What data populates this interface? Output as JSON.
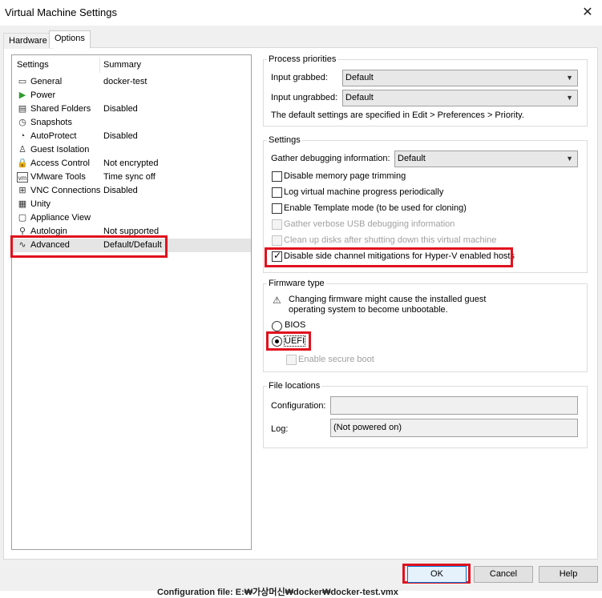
{
  "window": {
    "title": "Virtual Machine Settings",
    "close_glyph": "✕"
  },
  "tabs": [
    {
      "label": "Hardware"
    },
    {
      "label": "Options"
    }
  ],
  "settings_list": {
    "header_settings": "Settings",
    "header_summary": "Summary",
    "items": [
      {
        "label": "General",
        "summary": "docker-test",
        "icon": "general-icon",
        "glyph": "▭"
      },
      {
        "label": "Power",
        "summary": "",
        "icon": "power-icon",
        "glyph": "▶"
      },
      {
        "label": "Shared Folders",
        "summary": "Disabled",
        "icon": "shared-folders-icon",
        "glyph": "▤"
      },
      {
        "label": "Snapshots",
        "summary": "",
        "icon": "snapshots-icon",
        "glyph": "◷"
      },
      {
        "label": "AutoProtect",
        "summary": "Disabled",
        "icon": "autoprotect-icon",
        "glyph": "◔"
      },
      {
        "label": "Guest Isolation",
        "summary": "",
        "icon": "guest-isolation-icon",
        "glyph": "♙"
      },
      {
        "label": "Access Control",
        "summary": "Not encrypted",
        "icon": "access-control-icon",
        "glyph": "🔒"
      },
      {
        "label": "VMware Tools",
        "summary": "Time sync off",
        "icon": "vmware-tools-icon",
        "glyph": "vm"
      },
      {
        "label": "VNC Connections",
        "summary": "Disabled",
        "icon": "vnc-icon",
        "glyph": "⊞"
      },
      {
        "label": "Unity",
        "summary": "",
        "icon": "unity-icon",
        "glyph": "▦"
      },
      {
        "label": "Appliance View",
        "summary": "",
        "icon": "appliance-view-icon",
        "glyph": "▢"
      },
      {
        "label": "Autologin",
        "summary": "Not supported",
        "icon": "autologin-icon",
        "glyph": "⚲"
      },
      {
        "label": "Advanced",
        "summary": "Default/Default",
        "icon": "advanced-icon",
        "glyph": "∿"
      }
    ]
  },
  "process_priorities": {
    "title": "Process priorities",
    "input_grabbed_label": "Input grabbed:",
    "input_grabbed_value": "Default",
    "input_ungrabbed_label": "Input ungrabbed:",
    "input_ungrabbed_value": "Default",
    "note": "The default settings are specified in Edit > Preferences > Priority."
  },
  "settings_group": {
    "title": "Settings",
    "gather_label": "Gather debugging information:",
    "gather_value": "Default",
    "checkboxes": [
      {
        "label": "Disable memory page trimming",
        "checked": false,
        "disabled": false
      },
      {
        "label": "Log virtual machine progress periodically",
        "checked": false,
        "disabled": false
      },
      {
        "label": "Enable Template mode (to be used for cloning)",
        "checked": false,
        "disabled": false
      },
      {
        "label": "Gather verbose USB debugging information",
        "checked": false,
        "disabled": true
      },
      {
        "label": "Clean up disks after shutting down this virtual machine",
        "checked": false,
        "disabled": true
      },
      {
        "label": "Disable side channel mitigations for Hyper-V enabled hosts",
        "checked": true,
        "disabled": false
      }
    ]
  },
  "firmware": {
    "title": "Firmware type",
    "warning_line1": "Changing firmware might cause the installed guest",
    "warning_line2": "operating system to become unbootable.",
    "bios_label": "BIOS",
    "uefi_label": "UEFI",
    "secure_boot_label": "Enable secure boot",
    "selected": "UEFI"
  },
  "file_locations": {
    "title": "File locations",
    "configuration_label": "Configuration:",
    "log_label": "Log:",
    "log_value": "(Not powered on)"
  },
  "buttons": {
    "ok": "OK",
    "cancel": "Cancel",
    "help": "Help"
  },
  "status_bar": {
    "text": "Configuration file:  E:₩가상머신₩docker₩docker-test.vmx"
  },
  "colors": {
    "highlight_box": "#e0121e",
    "power_icon": "#2e9b2e"
  }
}
